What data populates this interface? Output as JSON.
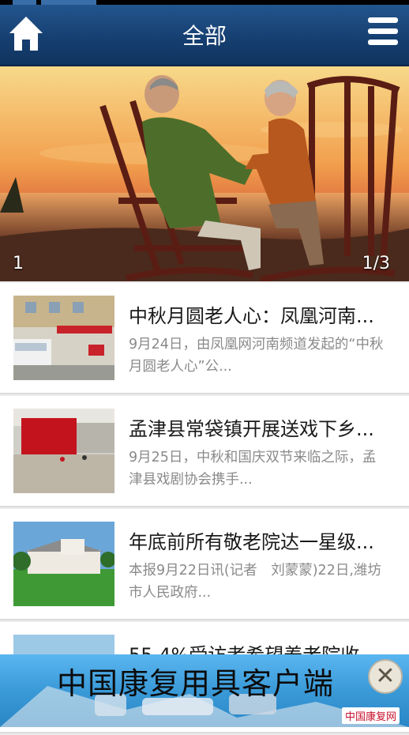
{
  "header": {
    "title": "全部"
  },
  "banner": {
    "index_label": "1",
    "counter": "1/3"
  },
  "news": [
    {
      "title": "中秋月圆老人心：凤凰河南...",
      "desc": "9月24日，由凤凰网河南频道发起的“中秋月圆老人心”公..."
    },
    {
      "title": "孟津县常袋镇开展送戏下乡...",
      "desc": "9月25日，中秋和国庆双节来临之际，孟津县戏剧协会携手..."
    },
    {
      "title": "年底前所有敬老院达一星级...",
      "desc": "本报9月22日讯(记者　刘蒙蒙)22日,潍坊市人民政府..."
    },
    {
      "title": "55.4%受访者希望养老院收...",
      "desc": ""
    }
  ],
  "ad": {
    "text": "中国康复用具客户端",
    "close_icon": "close-icon",
    "brand": "中国康复网"
  },
  "colors": {
    "topbar": "#153e6f",
    "ad_bg": "#3a9ad8"
  }
}
